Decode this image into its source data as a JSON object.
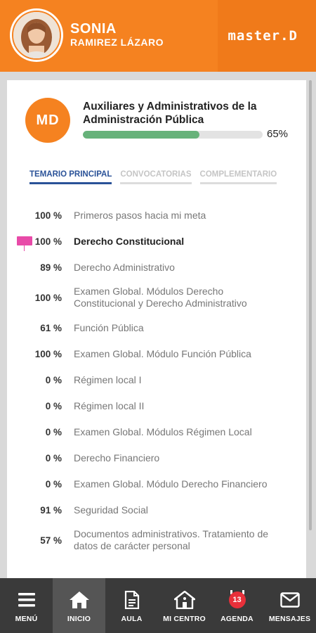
{
  "header": {
    "first_name": "SONIA",
    "last_name": "RAMIREZ LÁZARO",
    "brand": "master.D"
  },
  "course": {
    "logo": "MD",
    "title": "Auxiliares y Administrativos de la Administración Pública",
    "progress_label": "65%",
    "progress_value": 65
  },
  "tabs": [
    {
      "label": "TEMARIO PRINCIPAL",
      "active": true
    },
    {
      "label": "CONVOCATORIAS",
      "active": false
    },
    {
      "label": "COMPLEMENTARIO",
      "active": false
    }
  ],
  "modules": [
    {
      "pct": "100 %",
      "name": "Primeros pasos hacia mi meta"
    },
    {
      "pct": "100 %",
      "name": "Derecho Constitucional",
      "bold": true,
      "flag": true
    },
    {
      "pct": "89 %",
      "name": "Derecho Administrativo"
    },
    {
      "pct": "100 %",
      "name": "Examen Global. Módulos Derecho Constitucional y Derecho Administrativo"
    },
    {
      "pct": "61 %",
      "name": "Función Pública"
    },
    {
      "pct": "100 %",
      "name": "Examen Global. Módulo Función Pública"
    },
    {
      "pct": "0 %",
      "name": "Régimen local I"
    },
    {
      "pct": "0 %",
      "name": "Régimen local II"
    },
    {
      "pct": "0 %",
      "name": "Examen Global. Módulos Régimen Local"
    },
    {
      "pct": "0 %",
      "name": "Derecho Financiero"
    },
    {
      "pct": "0 %",
      "name": "Examen Global. Módulo Derecho Financiero"
    },
    {
      "pct": "91 %",
      "name": "Seguridad Social"
    },
    {
      "pct": "57 %",
      "name": "Documentos administrativos. Tratamiento de datos de carácter personal"
    }
  ],
  "nav": [
    {
      "label": "MENÚ",
      "icon": "hamburger-icon"
    },
    {
      "label": "INICIO",
      "icon": "home-icon",
      "active": true
    },
    {
      "label": "AULA",
      "icon": "document-icon"
    },
    {
      "label": "MI CENTRO",
      "icon": "school-icon"
    },
    {
      "label": "AGENDA",
      "icon": "calendar-icon",
      "badge": "13"
    },
    {
      "label": "MENSAJES",
      "icon": "mail-icon"
    }
  ],
  "colors": {
    "accent": "#f58220",
    "progress": "#67b27a",
    "tab_active": "#2a5298",
    "nav_bg": "#3a3a3a",
    "flag": "#e84aa8"
  }
}
